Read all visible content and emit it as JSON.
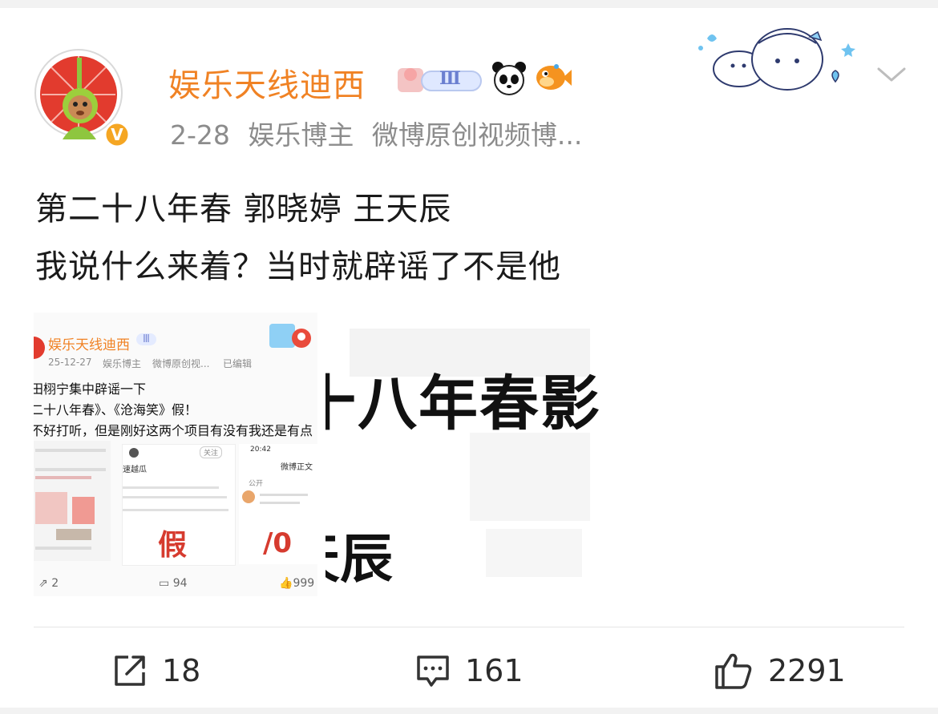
{
  "post": {
    "username": "娱乐天线迪西",
    "level_badge": "Ⅲ",
    "date": "2-28",
    "category": "娱乐博主",
    "subtitle": "微博原创视频博...",
    "lines": [
      "第二十八年春 郭晓婷 王天辰",
      "我说什么来着？当时就辟谣了不是他"
    ]
  },
  "image_left": {
    "username": "娱乐天线迪西",
    "badge": "Ⅲ",
    "date": "25-12-27",
    "category": "娱乐博主",
    "subtitle": "微博原创视...",
    "edited": "已编辑",
    "line1": "田栩宁集中辟谣一下",
    "line2": "二十八年春》、《沧海笑》假！",
    "line3": "不好打听，但是刚好这两个项目有没有我还是有点",
    "inner_follow": "关注",
    "inner_time": "20:42",
    "inner_title": "微博正文",
    "inner_public": "公开",
    "inner_tag": "速越瓜",
    "inner_stamp": "假",
    "reposts": "2",
    "comments": "94",
    "likes": "999"
  },
  "image_right": {
    "big_text": "十八年春影",
    "big_text2": "天辰"
  },
  "actions": {
    "reposts": "18",
    "comments": "161",
    "likes": "2291"
  },
  "colors": {
    "username": "#f08224",
    "meta": "#8c8c8c",
    "text": "#1a1a1a",
    "verified": "#f5a623"
  }
}
